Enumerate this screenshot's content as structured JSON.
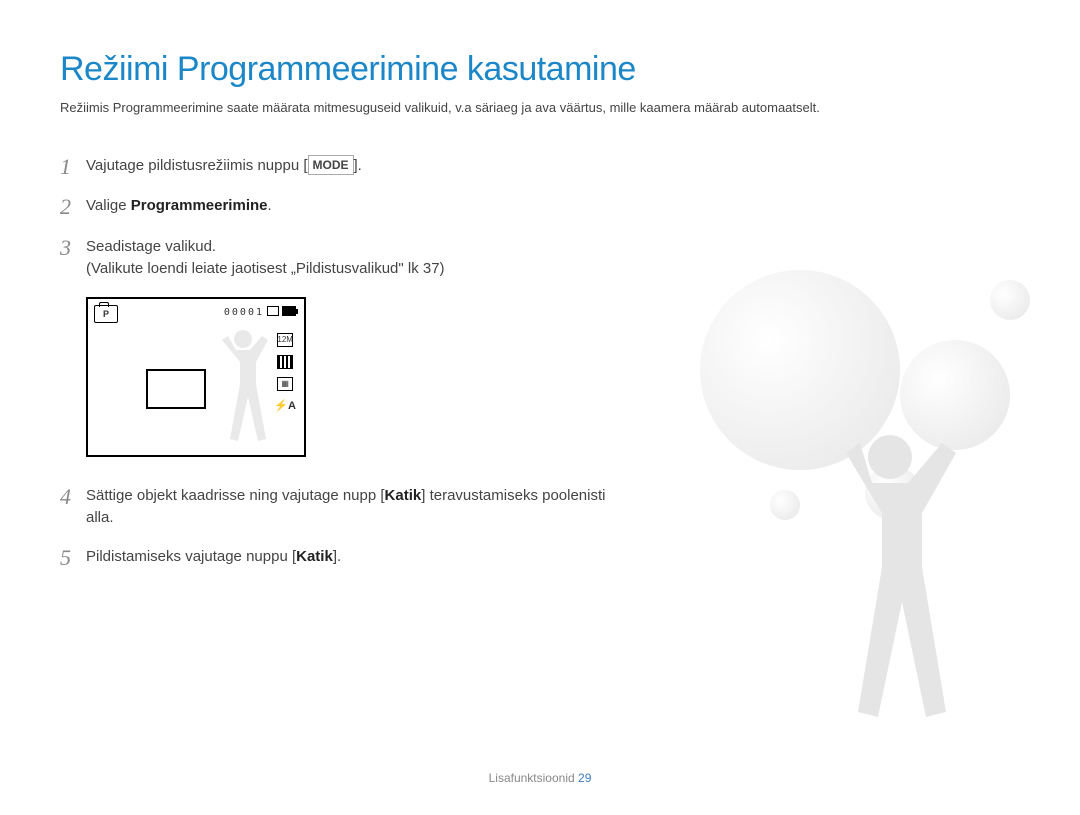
{
  "title": {
    "text": "Režiimi Programmeerimine kasutamine",
    "color": "#1b87c9"
  },
  "intro": "Režiimis Programmeerimine saate määrata mitmesuguseid valikuid, v.a säriaeg ja ava väärtus, mille kaamera määrab automaatselt.",
  "steps": {
    "s1": {
      "num": "1",
      "pre": "Vajutage pildistusrežiimis nuppu [",
      "mode": "MODE",
      "post": "]."
    },
    "s2": {
      "num": "2",
      "pre": "Valige ",
      "bold": "Programmeerimine",
      "post": "."
    },
    "s3": {
      "num": "3",
      "line1": "Seadistage valikud.",
      "line2": "(Valikute loendi leiate jaotisest „Pildistusvalikud\" lk 37)"
    },
    "s4": {
      "num": "4",
      "pre": "Sättige objekt kaadrisse ning vajutage nupp [",
      "bold": "Katik",
      "post": "] teravustamiseks poolenisti alla."
    },
    "s5": {
      "num": "5",
      "pre": "Pildistamiseks vajutage nuppu [",
      "bold": "Katik",
      "post": "]."
    }
  },
  "camera": {
    "mode_badge": "P",
    "counter": "00001",
    "icons": {
      "res": "12M",
      "flash": "A"
    }
  },
  "footer": {
    "section": "Lisafunktsioonid",
    "page": "29"
  }
}
